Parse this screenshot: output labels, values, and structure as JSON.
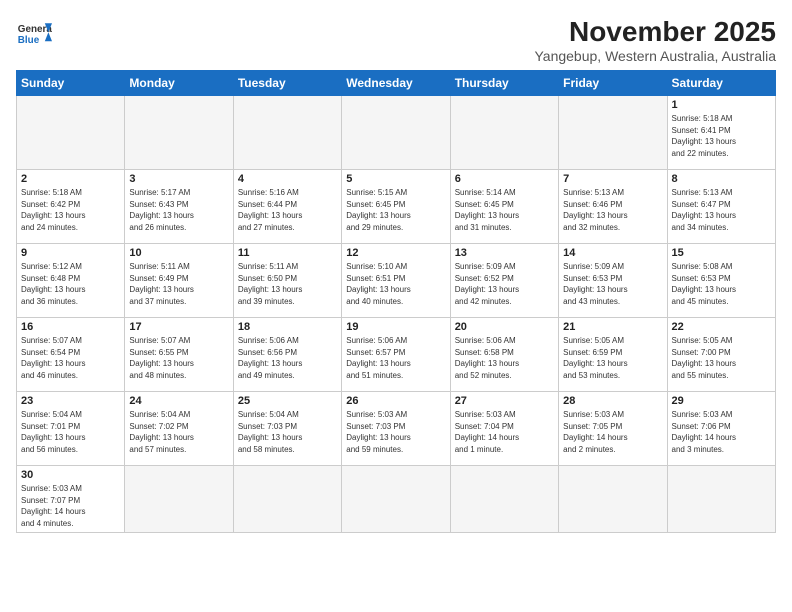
{
  "header": {
    "logo_general": "General",
    "logo_blue": "Blue",
    "month_title": "November 2025",
    "location": "Yangebup, Western Australia, Australia"
  },
  "days_of_week": [
    "Sunday",
    "Monday",
    "Tuesday",
    "Wednesday",
    "Thursday",
    "Friday",
    "Saturday"
  ],
  "weeks": [
    [
      {
        "day": "",
        "info": ""
      },
      {
        "day": "",
        "info": ""
      },
      {
        "day": "",
        "info": ""
      },
      {
        "day": "",
        "info": ""
      },
      {
        "day": "",
        "info": ""
      },
      {
        "day": "",
        "info": ""
      },
      {
        "day": "1",
        "info": "Sunrise: 5:18 AM\nSunset: 6:41 PM\nDaylight: 13 hours\nand 22 minutes."
      }
    ],
    [
      {
        "day": "2",
        "info": "Sunrise: 5:18 AM\nSunset: 6:42 PM\nDaylight: 13 hours\nand 24 minutes."
      },
      {
        "day": "3",
        "info": "Sunrise: 5:17 AM\nSunset: 6:43 PM\nDaylight: 13 hours\nand 26 minutes."
      },
      {
        "day": "4",
        "info": "Sunrise: 5:16 AM\nSunset: 6:44 PM\nDaylight: 13 hours\nand 27 minutes."
      },
      {
        "day": "5",
        "info": "Sunrise: 5:15 AM\nSunset: 6:45 PM\nDaylight: 13 hours\nand 29 minutes."
      },
      {
        "day": "6",
        "info": "Sunrise: 5:14 AM\nSunset: 6:45 PM\nDaylight: 13 hours\nand 31 minutes."
      },
      {
        "day": "7",
        "info": "Sunrise: 5:13 AM\nSunset: 6:46 PM\nDaylight: 13 hours\nand 32 minutes."
      },
      {
        "day": "8",
        "info": "Sunrise: 5:13 AM\nSunset: 6:47 PM\nDaylight: 13 hours\nand 34 minutes."
      }
    ],
    [
      {
        "day": "9",
        "info": "Sunrise: 5:12 AM\nSunset: 6:48 PM\nDaylight: 13 hours\nand 36 minutes."
      },
      {
        "day": "10",
        "info": "Sunrise: 5:11 AM\nSunset: 6:49 PM\nDaylight: 13 hours\nand 37 minutes."
      },
      {
        "day": "11",
        "info": "Sunrise: 5:11 AM\nSunset: 6:50 PM\nDaylight: 13 hours\nand 39 minutes."
      },
      {
        "day": "12",
        "info": "Sunrise: 5:10 AM\nSunset: 6:51 PM\nDaylight: 13 hours\nand 40 minutes."
      },
      {
        "day": "13",
        "info": "Sunrise: 5:09 AM\nSunset: 6:52 PM\nDaylight: 13 hours\nand 42 minutes."
      },
      {
        "day": "14",
        "info": "Sunrise: 5:09 AM\nSunset: 6:53 PM\nDaylight: 13 hours\nand 43 minutes."
      },
      {
        "day": "15",
        "info": "Sunrise: 5:08 AM\nSunset: 6:53 PM\nDaylight: 13 hours\nand 45 minutes."
      }
    ],
    [
      {
        "day": "16",
        "info": "Sunrise: 5:07 AM\nSunset: 6:54 PM\nDaylight: 13 hours\nand 46 minutes."
      },
      {
        "day": "17",
        "info": "Sunrise: 5:07 AM\nSunset: 6:55 PM\nDaylight: 13 hours\nand 48 minutes."
      },
      {
        "day": "18",
        "info": "Sunrise: 5:06 AM\nSunset: 6:56 PM\nDaylight: 13 hours\nand 49 minutes."
      },
      {
        "day": "19",
        "info": "Sunrise: 5:06 AM\nSunset: 6:57 PM\nDaylight: 13 hours\nand 51 minutes."
      },
      {
        "day": "20",
        "info": "Sunrise: 5:06 AM\nSunset: 6:58 PM\nDaylight: 13 hours\nand 52 minutes."
      },
      {
        "day": "21",
        "info": "Sunrise: 5:05 AM\nSunset: 6:59 PM\nDaylight: 13 hours\nand 53 minutes."
      },
      {
        "day": "22",
        "info": "Sunrise: 5:05 AM\nSunset: 7:00 PM\nDaylight: 13 hours\nand 55 minutes."
      }
    ],
    [
      {
        "day": "23",
        "info": "Sunrise: 5:04 AM\nSunset: 7:01 PM\nDaylight: 13 hours\nand 56 minutes."
      },
      {
        "day": "24",
        "info": "Sunrise: 5:04 AM\nSunset: 7:02 PM\nDaylight: 13 hours\nand 57 minutes."
      },
      {
        "day": "25",
        "info": "Sunrise: 5:04 AM\nSunset: 7:03 PM\nDaylight: 13 hours\nand 58 minutes."
      },
      {
        "day": "26",
        "info": "Sunrise: 5:03 AM\nSunset: 7:03 PM\nDaylight: 13 hours\nand 59 minutes."
      },
      {
        "day": "27",
        "info": "Sunrise: 5:03 AM\nSunset: 7:04 PM\nDaylight: 14 hours\nand 1 minute."
      },
      {
        "day": "28",
        "info": "Sunrise: 5:03 AM\nSunset: 7:05 PM\nDaylight: 14 hours\nand 2 minutes."
      },
      {
        "day": "29",
        "info": "Sunrise: 5:03 AM\nSunset: 7:06 PM\nDaylight: 14 hours\nand 3 minutes."
      }
    ],
    [
      {
        "day": "30",
        "info": "Sunrise: 5:03 AM\nSunset: 7:07 PM\nDaylight: 14 hours\nand 4 minutes."
      },
      {
        "day": "",
        "info": ""
      },
      {
        "day": "",
        "info": ""
      },
      {
        "day": "",
        "info": ""
      },
      {
        "day": "",
        "info": ""
      },
      {
        "day": "",
        "info": ""
      },
      {
        "day": "",
        "info": ""
      }
    ]
  ]
}
